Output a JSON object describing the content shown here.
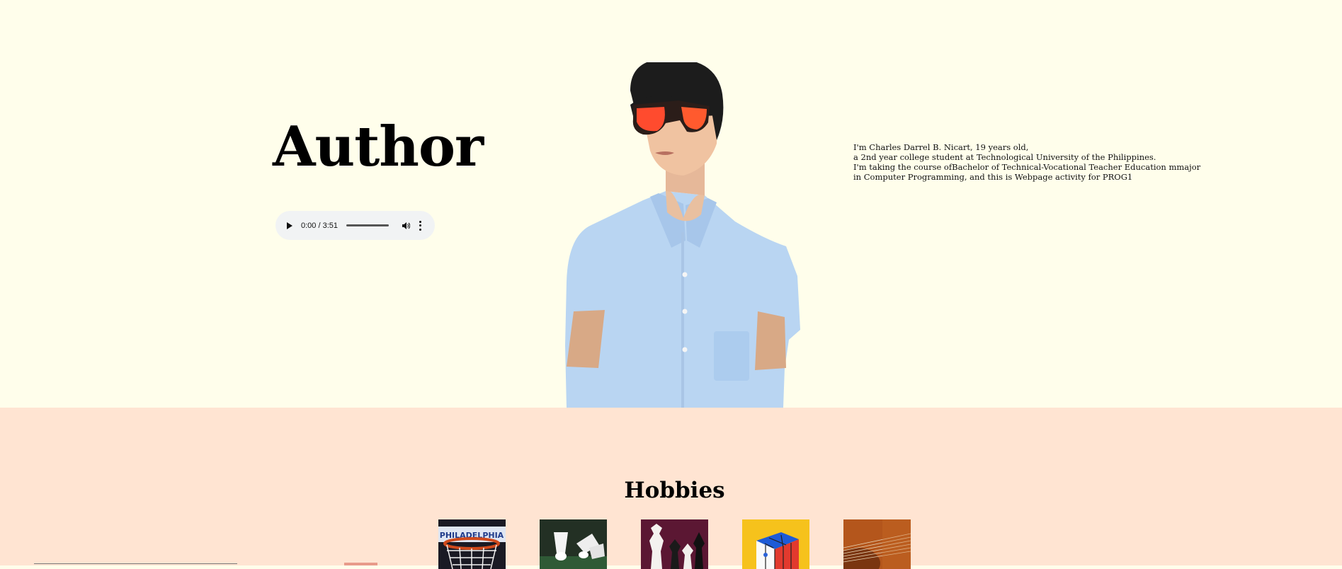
{
  "hero": {
    "title": "Author",
    "audio": {
      "time": "0:00 / 3:51",
      "icons": [
        "play-icon",
        "volume-icon",
        "more-options-icon"
      ]
    },
    "bio": [
      "I'm Charles Darrel B. Nicart, 19 years old,",
      "a 2nd year college student at Technological University of the Philippines.",
      "I'm taking the course ofBachelor of Technical-Vocational Teacher Education mmajor in Computer Programming, and this is Webpage activity for PROG1"
    ]
  },
  "hobbies": {
    "title": "Hobbies",
    "items": [
      "basketball",
      "badminton",
      "chess",
      "rubiks-cube",
      "guitar"
    ]
  },
  "colors": {
    "hero_bg": "#fffeeb",
    "hobbies_bg": "#ffe4d2",
    "audio_bg": "#f1f3f4"
  }
}
